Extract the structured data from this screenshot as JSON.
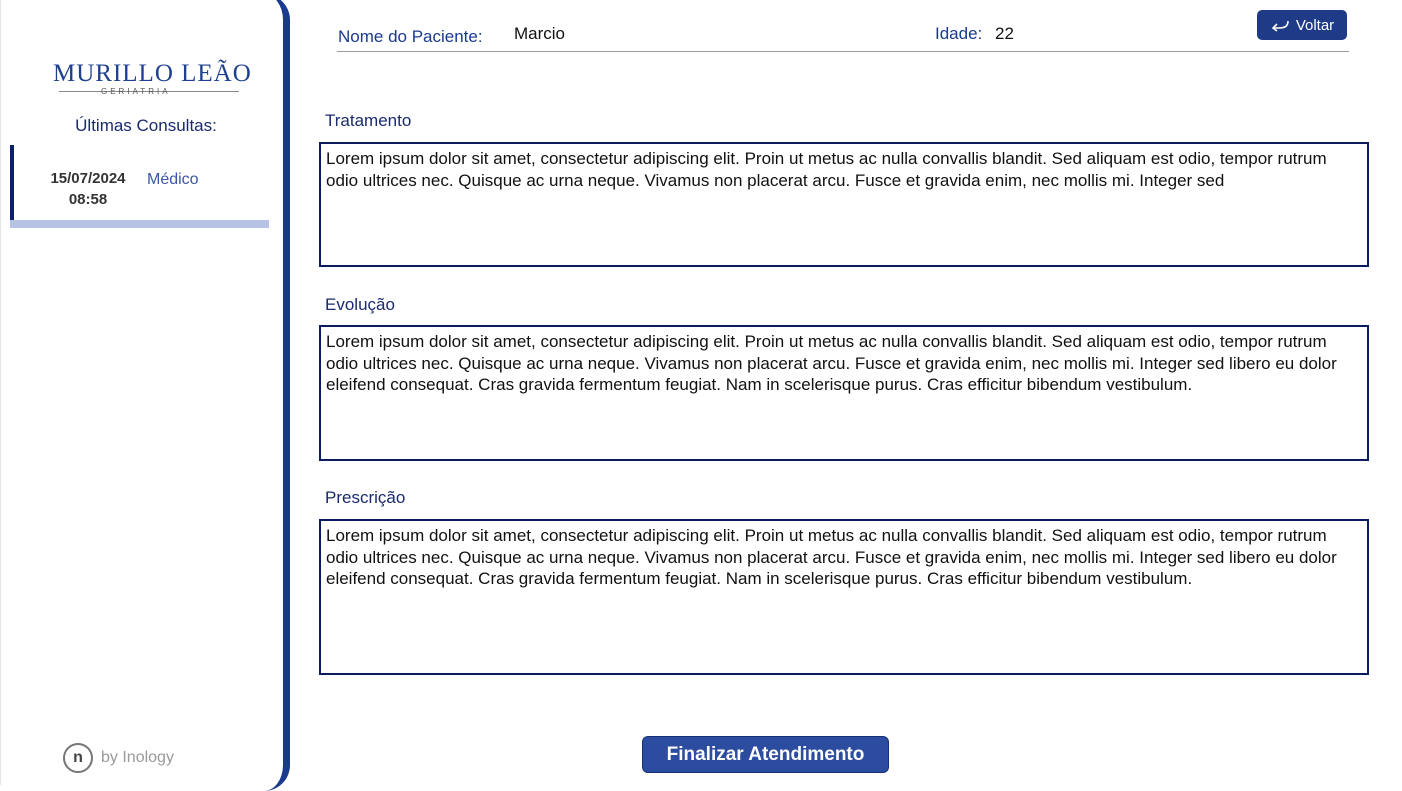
{
  "sidebar": {
    "logo_text": "MURILLO LEÃO",
    "logo_subtitle": "GERIATRIA",
    "last_consults_title": "Últimas Consultas:",
    "consults": [
      {
        "date": "15/07/2024",
        "time": "08:58",
        "type": "Médico"
      }
    ],
    "footer_text": "by Inology",
    "footer_icon_letter": "n"
  },
  "header": {
    "patient_label": "Nome do Paciente:",
    "patient_name": "Marcio",
    "age_label": "Idade:",
    "age_value": "22",
    "back_label": "Voltar"
  },
  "sections": {
    "treatment": {
      "label": "Tratamento",
      "text": "Lorem ipsum dolor sit amet, consectetur adipiscing elit. Proin ut metus ac nulla convallis blandit. Sed aliquam est odio, tempor rutrum odio ultrices nec. Quisque ac urna neque. Vivamus non placerat arcu. Fusce et gravida enim, nec mollis mi. Integer sed"
    },
    "evolution": {
      "label": "Evolução",
      "text": "Lorem ipsum dolor sit amet, consectetur adipiscing elit. Proin ut metus ac nulla convallis blandit. Sed aliquam est odio, tempor rutrum odio ultrices nec. Quisque ac urna neque. Vivamus non placerat arcu. Fusce et gravida enim, nec mollis mi. Integer sed libero eu dolor eleifend consequat. Cras gravida fermentum feugiat. Nam in scelerisque purus. Cras efficitur bibendum vestibulum."
    },
    "prescription": {
      "label": "Prescrição",
      "text": "Lorem ipsum dolor sit amet, consectetur adipiscing elit. Proin ut metus ac nulla convallis blandit. Sed aliquam est odio, tempor rutrum odio ultrices nec. Quisque ac urna neque. Vivamus non placerat arcu. Fusce et gravida enim, nec mollis mi. Integer sed libero eu dolor eleifend consequat. Cras gravida fermentum feugiat. Nam in scelerisque purus. Cras efficitur bibendum vestibulum."
    }
  },
  "actions": {
    "finish_label": "Finalizar Atendimento"
  },
  "colors": {
    "accent": "#1a3a8f",
    "button": "#2c4ca0",
    "text_box_border": "#0c1a5e",
    "consult_highlight": "#b7c3e5"
  }
}
